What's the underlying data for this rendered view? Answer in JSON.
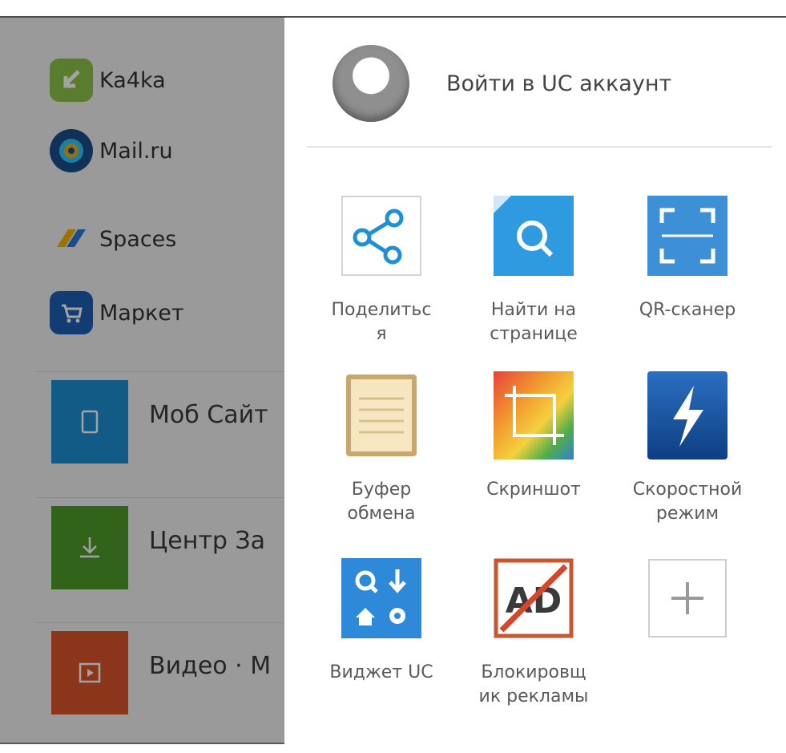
{
  "bookmarks": [
    {
      "label": "Ka4ka",
      "icon": "ka4ka-icon",
      "color": "#8bc34a"
    },
    {
      "label": "Mail.ru",
      "icon": "mailru-icon",
      "color": "#1a4f8b"
    },
    {
      "label": "Spaces",
      "icon": "spaces-icon",
      "color": "#2b7bd6"
    },
    {
      "label": "Маркет",
      "icon": "market-icon",
      "color": "#1e5fb3"
    }
  ],
  "tiles": [
    {
      "label": "Моб Сайт",
      "icon": "phone-icon",
      "color": "#1b8fd2"
    },
    {
      "label": "Центр За",
      "icon": "download-icon",
      "color": "#4f9b2a"
    },
    {
      "label": "Видео · М",
      "icon": "video-icon",
      "color": "#d9542a"
    }
  ],
  "account": {
    "label": "Войти в UC аккаунт",
    "icon": "avatar-icon"
  },
  "tools": [
    {
      "label": "Поделитьс\nя",
      "icon": "share-icon"
    },
    {
      "label": "Найти на\nстранице",
      "icon": "find-on-page-icon"
    },
    {
      "label": "QR-сканер",
      "icon": "qr-scanner-icon"
    },
    {
      "label": "Буфер\nобмена",
      "icon": "clipboard-icon"
    },
    {
      "label": "Скриншот",
      "icon": "screenshot-icon"
    },
    {
      "label": "Скоростной\nрежим",
      "icon": "speed-mode-icon"
    },
    {
      "label": "Виджет UC",
      "icon": "uc-widget-icon"
    },
    {
      "label": "Блокировщ\nик рекламы",
      "icon": "ad-blocker-icon"
    },
    {
      "label": "",
      "icon": "add-icon"
    }
  ]
}
